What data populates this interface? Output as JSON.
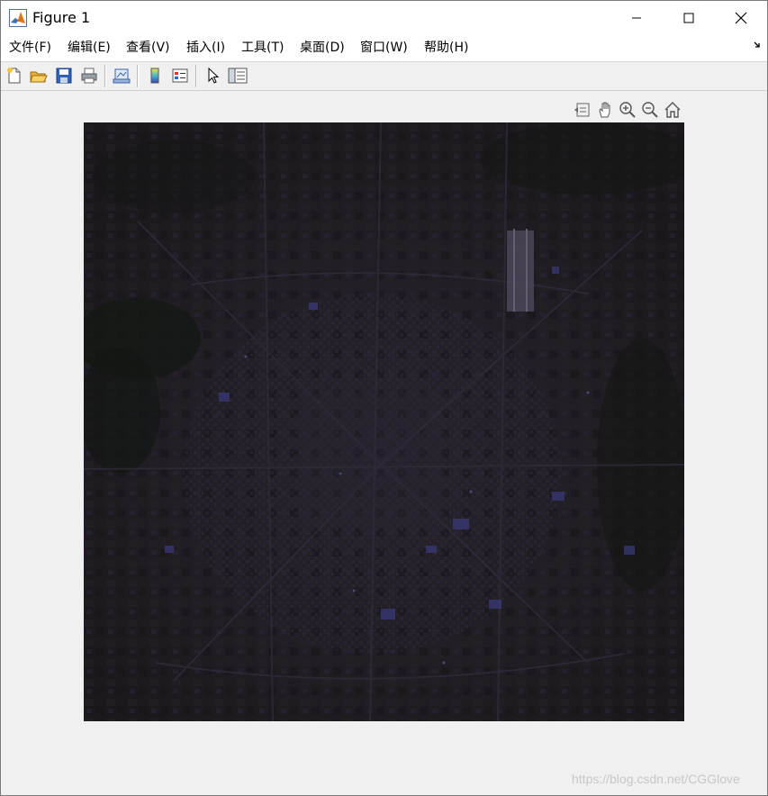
{
  "window": {
    "title": "Figure 1",
    "controls": [
      "minimize",
      "maximize",
      "close"
    ]
  },
  "menu": {
    "items": [
      {
        "label": "文件(F)"
      },
      {
        "label": "编辑(E)"
      },
      {
        "label": "查看(V)"
      },
      {
        "label": "插入(I)"
      },
      {
        "label": "工具(T)"
      },
      {
        "label": "桌面(D)"
      },
      {
        "label": "窗口(W)"
      },
      {
        "label": "帮助(H)"
      }
    ]
  },
  "toolbar": {
    "buttons": [
      "new-figure-icon",
      "open-file-icon",
      "save-icon",
      "print-icon",
      "link-plot-icon",
      "colorbar-icon",
      "legend-icon",
      "select-pointer-icon",
      "property-inspector-icon"
    ]
  },
  "axes_toolbar": {
    "buttons": [
      "export-icon",
      "pan-icon",
      "zoom-in-icon",
      "zoom-out-icon",
      "home-icon"
    ]
  },
  "image": {
    "description_colors": {
      "base": "#1d1a1e",
      "dark_green": "#141a14",
      "blue_accent": "#3a3a7a",
      "grey_purple": "#2a2530"
    }
  },
  "watermark": {
    "text": "https://blog.csdn.net/CGGlove"
  }
}
